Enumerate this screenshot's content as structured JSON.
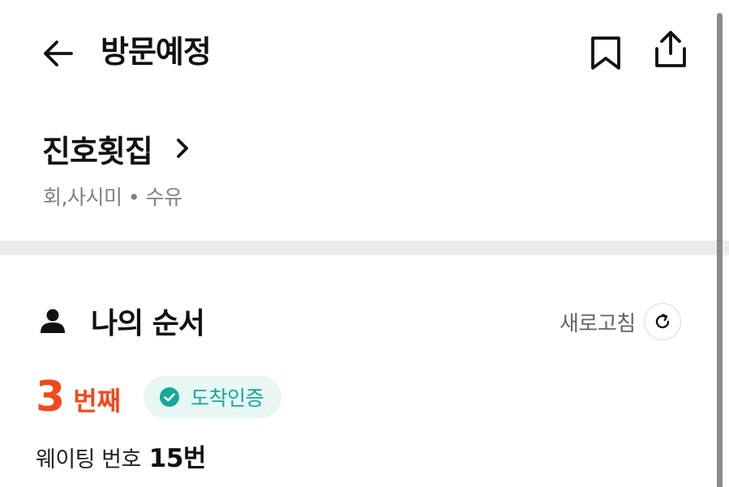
{
  "header": {
    "title": "방문예정",
    "back_icon": "arrow-left-icon",
    "bookmark_icon": "bookmark-icon",
    "share_icon": "share-icon"
  },
  "store": {
    "name": "진호횟집",
    "category": "회,사시미 • 수유"
  },
  "my_order": {
    "title": "나의 순서",
    "refresh_label": "새로고침",
    "rank_number": "3",
    "rank_unit": "번째",
    "badge_label": "도착인증",
    "waiting_label": "웨이팅 번호",
    "waiting_number": "15번"
  },
  "colors": {
    "accent": "#f2491c",
    "badge_text": "#14a89a",
    "badge_bg": "#e8f6f4",
    "divider": "#ececec",
    "muted_text": "#7b7f86"
  }
}
